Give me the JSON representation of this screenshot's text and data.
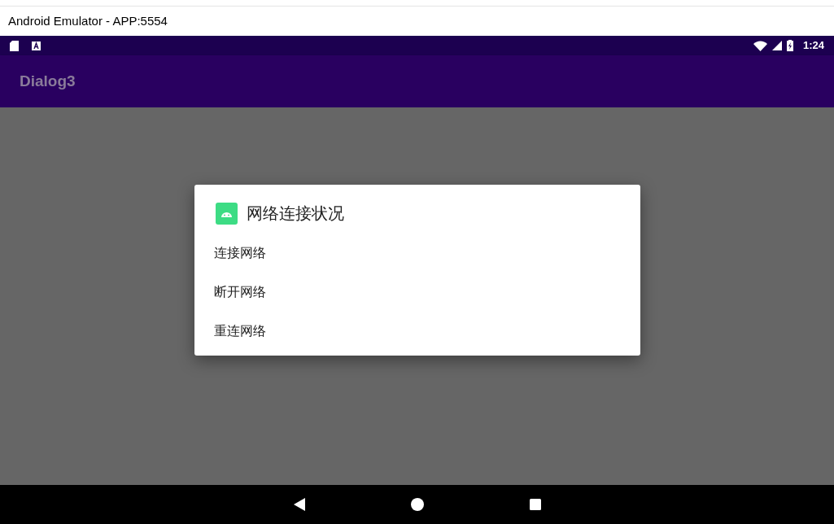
{
  "window": {
    "title": "Android Emulator - APP:5554"
  },
  "status_bar": {
    "time": "1:24"
  },
  "app_bar": {
    "title": "Dialog3"
  },
  "dialog": {
    "title": "网络连接状况",
    "items": [
      {
        "label": "连接网络"
      },
      {
        "label": "断开网络"
      },
      {
        "label": "重连网络"
      }
    ]
  }
}
